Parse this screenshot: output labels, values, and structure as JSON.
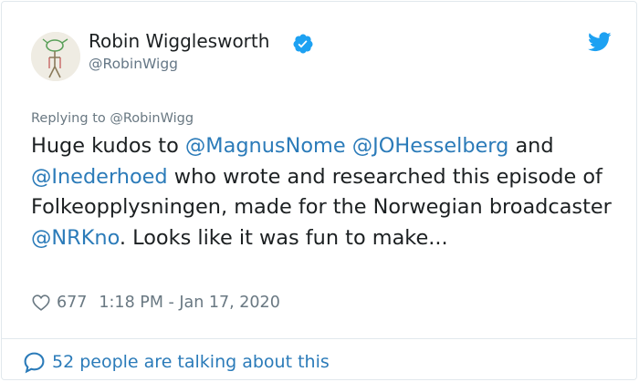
{
  "author": {
    "name": "Robin Wigglesworth",
    "handle": "@RobinWigg"
  },
  "reply": {
    "replying_to_label": "Replying to @RobinWigg"
  },
  "tweet": {
    "segments": [
      {
        "text": "Huge kudos to ",
        "kind": "text"
      },
      {
        "text": "@MagnusNome",
        "kind": "mention"
      },
      {
        "text": " ",
        "kind": "text"
      },
      {
        "text": "@JOHesselberg",
        "kind": "mention"
      },
      {
        "text": " and ",
        "kind": "text"
      },
      {
        "text": "@Inederhoed",
        "kind": "mention"
      },
      {
        "text": " who wrote and researched this episode of Folkeopplysningen, made for the Norwegian broadcaster ",
        "kind": "text"
      },
      {
        "text": "@NRKno",
        "kind": "mention"
      },
      {
        "text": ". Looks like it was fun to make...",
        "kind": "text"
      }
    ]
  },
  "meta": {
    "likes": "677",
    "timestamp": "1:18 PM - Jan 17, 2020"
  },
  "footer": {
    "talking_label": "52 people are talking about this"
  },
  "icons": {
    "verified": "verified-badge-icon",
    "bird": "twitter-bird-icon",
    "heart": "heart-outline-icon",
    "bubble": "speech-bubble-icon"
  },
  "colors": {
    "link": "#2b7bb9",
    "muted": "#697882",
    "verified": "#1da1f2"
  }
}
